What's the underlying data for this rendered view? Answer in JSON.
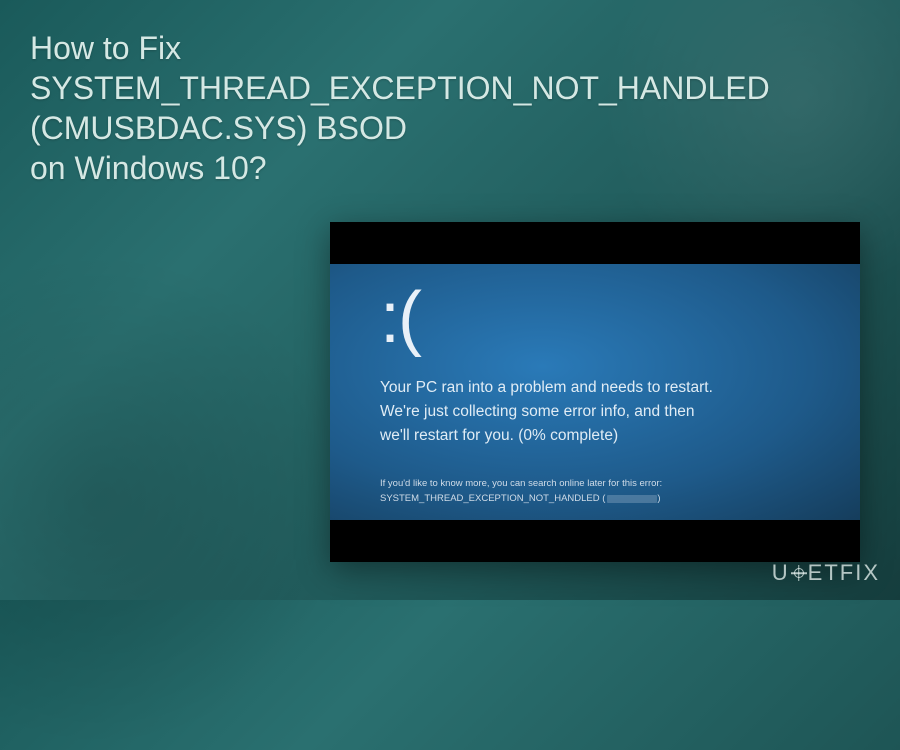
{
  "title": {
    "line1": "How to Fix",
    "line2": "SYSTEM_THREAD_EXCEPTION_NOT_HANDLED",
    "line3": "(CMUSBDAC.SYS) BSOD",
    "line4": "on Windows 10?"
  },
  "bsod": {
    "face": ":(",
    "msg_line1": "Your PC ran into a problem and needs to restart.",
    "msg_line2": "We're just collecting some error info, and then",
    "msg_line3": "we'll restart for you. (0% complete)",
    "details_line1": "If you'd like to know more, you can search online later for this error:",
    "details_error": "SYSTEM_THREAD_EXCEPTION_NOT_HANDLED"
  },
  "watermark": {
    "part1": "U",
    "part2": "ETFIX"
  }
}
